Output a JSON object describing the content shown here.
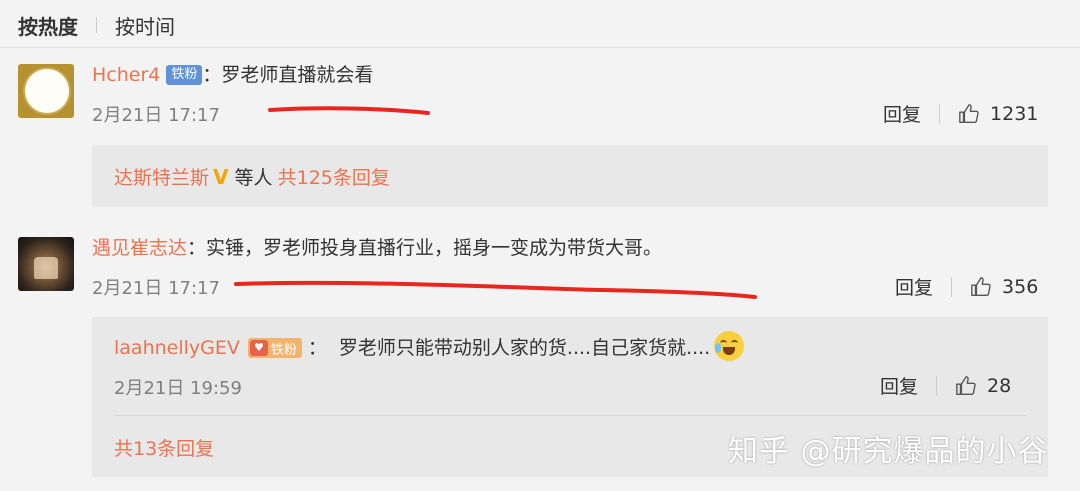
{
  "tabs": {
    "hot": "按热度",
    "time": "按时间"
  },
  "comments": [
    {
      "user": "Hcher4",
      "badge": "铁粉",
      "sep": "：",
      "text": "罗老师直播就会看",
      "time": "2月21日 17:17",
      "reply_label": "回复",
      "likes": "1231",
      "replies_preview": {
        "user": "达斯特兰斯",
        "v": "V",
        "middle": "等人",
        "count_text": "共125条回复"
      }
    },
    {
      "user": "遇见崔志达",
      "sep": "：",
      "text": "实锤，罗老师投身直播行业，摇身一变成为带货大哥。",
      "time": "2月21日 17:17",
      "reply_label": "回复",
      "likes": "356",
      "sub_reply": {
        "user": "laahnellyGEV",
        "badge": "铁粉",
        "sep": "：",
        "text": "罗老师只能带动别人家的货....自己家货就....",
        "time": "2月21日 19:59",
        "reply_label": "回复",
        "likes": "28"
      },
      "more_replies": "共13条回复"
    }
  ],
  "watermark": "知乎 @研究爆品的小谷",
  "colors": {
    "username": "#eb7350",
    "badge_blue": "#5f92d7",
    "annotation": "#e8281e"
  }
}
